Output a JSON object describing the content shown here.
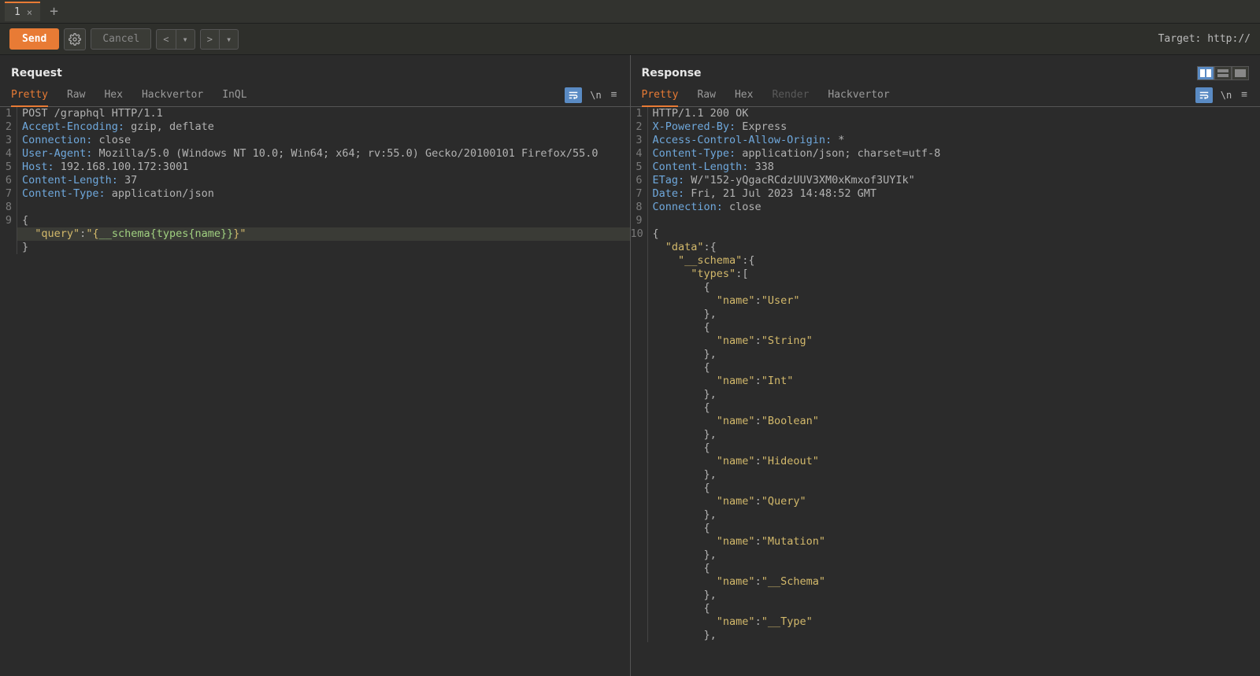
{
  "tabbar": {
    "tab_label": "1",
    "close_glyph": "×",
    "add_glyph": "+"
  },
  "toolbar": {
    "send_label": "Send",
    "cancel_label": "Cancel",
    "prev_glyph": "<",
    "next_glyph": ">",
    "dd_glyph": "▾",
    "target_label": "Target: http://"
  },
  "panes": {
    "request_title": "Request",
    "response_title": "Response"
  },
  "subtabs": {
    "pretty": "Pretty",
    "raw": "Raw",
    "hex": "Hex",
    "hackvertor": "Hackvertor",
    "inql": "InQL",
    "render": "Render",
    "newline_glyph": "\\n",
    "menu_glyph": "≡"
  },
  "request_lines": [
    {
      "n": "1",
      "segs": [
        {
          "t": "POST /graphql HTTP/1.1",
          "c": ""
        }
      ]
    },
    {
      "n": "2",
      "segs": [
        {
          "t": "Accept-Encoding:",
          "c": "hdr"
        },
        {
          "t": " gzip, deflate",
          "c": ""
        }
      ]
    },
    {
      "n": "3",
      "segs": [
        {
          "t": "Connection:",
          "c": "hdr"
        },
        {
          "t": " close",
          "c": ""
        }
      ]
    },
    {
      "n": "4",
      "segs": [
        {
          "t": "User-Agent:",
          "c": "hdr"
        },
        {
          "t": " Mozilla/5.0 (Windows NT 10.0; Win64; x64; rv:55.0) Gecko/20100101 Firefox/55.0",
          "c": ""
        }
      ]
    },
    {
      "n": "5",
      "segs": [
        {
          "t": "Host:",
          "c": "hdr"
        },
        {
          "t": " 192.168.100.172:3001",
          "c": ""
        }
      ]
    },
    {
      "n": "6",
      "segs": [
        {
          "t": "Content-Length:",
          "c": "hdr"
        },
        {
          "t": " 37",
          "c": ""
        }
      ]
    },
    {
      "n": "7",
      "segs": [
        {
          "t": "Content-Type:",
          "c": "hdr"
        },
        {
          "t": " application/json",
          "c": ""
        }
      ]
    },
    {
      "n": "8",
      "segs": [
        {
          "t": "",
          "c": ""
        }
      ]
    },
    {
      "n": "9",
      "segs": [
        {
          "t": "{",
          "c": ""
        }
      ]
    },
    {
      "n": "",
      "hl": true,
      "segs": [
        {
          "t": "  ",
          "c": ""
        },
        {
          "t": "\"query\"",
          "c": "key"
        },
        {
          "t": ":",
          "c": ""
        },
        {
          "t": "\"{",
          "c": "str"
        },
        {
          "t": "__schema{types{name}}",
          "c": "schem"
        },
        {
          "t": "}\"",
          "c": "str"
        }
      ]
    },
    {
      "n": "",
      "segs": [
        {
          "t": "}",
          "c": ""
        }
      ]
    }
  ],
  "response_lines": [
    {
      "n": "1",
      "segs": [
        {
          "t": "HTTP/1.1 200 OK",
          "c": ""
        }
      ]
    },
    {
      "n": "2",
      "segs": [
        {
          "t": "X-Powered-By:",
          "c": "hdr"
        },
        {
          "t": " Express",
          "c": ""
        }
      ]
    },
    {
      "n": "3",
      "segs": [
        {
          "t": "Access-Control-Allow-Origin:",
          "c": "hdr"
        },
        {
          "t": " *",
          "c": ""
        }
      ]
    },
    {
      "n": "4",
      "segs": [
        {
          "t": "Content-Type:",
          "c": "hdr"
        },
        {
          "t": " application/json; charset=utf-8",
          "c": ""
        }
      ]
    },
    {
      "n": "5",
      "segs": [
        {
          "t": "Content-Length:",
          "c": "hdr"
        },
        {
          "t": " 338",
          "c": ""
        }
      ]
    },
    {
      "n": "6",
      "segs": [
        {
          "t": "ETag:",
          "c": "hdr"
        },
        {
          "t": " W/\"152-yQgacRCdzUUV3XM0xKmxof3UYIk\"",
          "c": ""
        }
      ]
    },
    {
      "n": "7",
      "segs": [
        {
          "t": "Date:",
          "c": "hdr"
        },
        {
          "t": " Fri, 21 Jul 2023 14:48:52 GMT",
          "c": ""
        }
      ]
    },
    {
      "n": "8",
      "segs": [
        {
          "t": "Connection:",
          "c": "hdr"
        },
        {
          "t": " close",
          "c": ""
        }
      ]
    },
    {
      "n": "9",
      "segs": [
        {
          "t": "",
          "c": ""
        }
      ]
    },
    {
      "n": "10",
      "segs": [
        {
          "t": "{",
          "c": ""
        }
      ]
    },
    {
      "n": "",
      "segs": [
        {
          "t": "  ",
          "c": ""
        },
        {
          "t": "\"data\"",
          "c": "key"
        },
        {
          "t": ":{",
          "c": ""
        }
      ]
    },
    {
      "n": "",
      "segs": [
        {
          "t": "    ",
          "c": ""
        },
        {
          "t": "\"__schema\"",
          "c": "key"
        },
        {
          "t": ":{",
          "c": ""
        }
      ]
    },
    {
      "n": "",
      "segs": [
        {
          "t": "      ",
          "c": ""
        },
        {
          "t": "\"types\"",
          "c": "key"
        },
        {
          "t": ":[",
          "c": ""
        }
      ]
    },
    {
      "n": "",
      "segs": [
        {
          "t": "        {",
          "c": ""
        }
      ]
    },
    {
      "n": "",
      "segs": [
        {
          "t": "          ",
          "c": ""
        },
        {
          "t": "\"name\"",
          "c": "key"
        },
        {
          "t": ":",
          "c": ""
        },
        {
          "t": "\"User\"",
          "c": "str"
        }
      ]
    },
    {
      "n": "",
      "segs": [
        {
          "t": "        },",
          "c": ""
        }
      ]
    },
    {
      "n": "",
      "segs": [
        {
          "t": "        {",
          "c": ""
        }
      ]
    },
    {
      "n": "",
      "segs": [
        {
          "t": "          ",
          "c": ""
        },
        {
          "t": "\"name\"",
          "c": "key"
        },
        {
          "t": ":",
          "c": ""
        },
        {
          "t": "\"String\"",
          "c": "str"
        }
      ]
    },
    {
      "n": "",
      "segs": [
        {
          "t": "        },",
          "c": ""
        }
      ]
    },
    {
      "n": "",
      "segs": [
        {
          "t": "        {",
          "c": ""
        }
      ]
    },
    {
      "n": "",
      "segs": [
        {
          "t": "          ",
          "c": ""
        },
        {
          "t": "\"name\"",
          "c": "key"
        },
        {
          "t": ":",
          "c": ""
        },
        {
          "t": "\"Int\"",
          "c": "str"
        }
      ]
    },
    {
      "n": "",
      "segs": [
        {
          "t": "        },",
          "c": ""
        }
      ]
    },
    {
      "n": "",
      "segs": [
        {
          "t": "        {",
          "c": ""
        }
      ]
    },
    {
      "n": "",
      "segs": [
        {
          "t": "          ",
          "c": ""
        },
        {
          "t": "\"name\"",
          "c": "key"
        },
        {
          "t": ":",
          "c": ""
        },
        {
          "t": "\"Boolean\"",
          "c": "str"
        }
      ]
    },
    {
      "n": "",
      "segs": [
        {
          "t": "        },",
          "c": ""
        }
      ]
    },
    {
      "n": "",
      "segs": [
        {
          "t": "        {",
          "c": ""
        }
      ]
    },
    {
      "n": "",
      "segs": [
        {
          "t": "          ",
          "c": ""
        },
        {
          "t": "\"name\"",
          "c": "key"
        },
        {
          "t": ":",
          "c": ""
        },
        {
          "t": "\"Hideout\"",
          "c": "str"
        }
      ]
    },
    {
      "n": "",
      "segs": [
        {
          "t": "        },",
          "c": ""
        }
      ]
    },
    {
      "n": "",
      "segs": [
        {
          "t": "        {",
          "c": ""
        }
      ]
    },
    {
      "n": "",
      "segs": [
        {
          "t": "          ",
          "c": ""
        },
        {
          "t": "\"name\"",
          "c": "key"
        },
        {
          "t": ":",
          "c": ""
        },
        {
          "t": "\"Query\"",
          "c": "str"
        }
      ]
    },
    {
      "n": "",
      "segs": [
        {
          "t": "        },",
          "c": ""
        }
      ]
    },
    {
      "n": "",
      "segs": [
        {
          "t": "        {",
          "c": ""
        }
      ]
    },
    {
      "n": "",
      "segs": [
        {
          "t": "          ",
          "c": ""
        },
        {
          "t": "\"name\"",
          "c": "key"
        },
        {
          "t": ":",
          "c": ""
        },
        {
          "t": "\"Mutation\"",
          "c": "str"
        }
      ]
    },
    {
      "n": "",
      "segs": [
        {
          "t": "        },",
          "c": ""
        }
      ]
    },
    {
      "n": "",
      "segs": [
        {
          "t": "        {",
          "c": ""
        }
      ]
    },
    {
      "n": "",
      "segs": [
        {
          "t": "          ",
          "c": ""
        },
        {
          "t": "\"name\"",
          "c": "key"
        },
        {
          "t": ":",
          "c": ""
        },
        {
          "t": "\"__Schema\"",
          "c": "str"
        }
      ]
    },
    {
      "n": "",
      "segs": [
        {
          "t": "        },",
          "c": ""
        }
      ]
    },
    {
      "n": "",
      "segs": [
        {
          "t": "        {",
          "c": ""
        }
      ]
    },
    {
      "n": "",
      "segs": [
        {
          "t": "          ",
          "c": ""
        },
        {
          "t": "\"name\"",
          "c": "key"
        },
        {
          "t": ":",
          "c": ""
        },
        {
          "t": "\"__Type\"",
          "c": "str"
        }
      ]
    },
    {
      "n": "",
      "segs": [
        {
          "t": "        },",
          "c": ""
        }
      ]
    }
  ]
}
